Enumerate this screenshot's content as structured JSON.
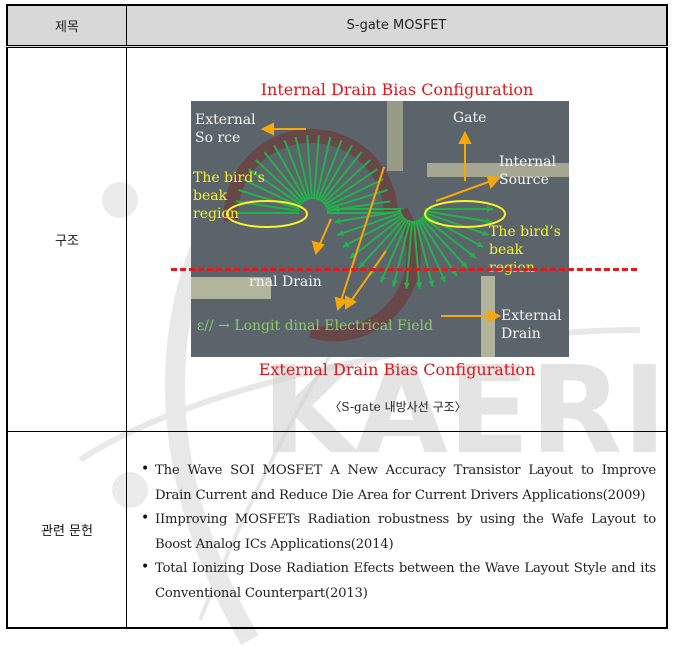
{
  "table": {
    "header": {
      "label": "제목",
      "value": "S-gate MOSFET"
    },
    "structure": {
      "label": "구조",
      "figure": {
        "title_top": "Internal Drain Bias Configuration",
        "title_bottom": "External Drain Bias Configuration",
        "labels": {
          "external_source": "External\nSo rce",
          "gate": "Gate",
          "internal_source": "Internal\nSource",
          "birds_beak_left": "The bird’s\nbeak\nregion",
          "birds_beak_right": "The bird’s\nbeak\nregion",
          "internal_drain": "rnal Drain",
          "legend": "ε// → Longit dinal Electrical Field",
          "external_drain": "External\nDrain"
        },
        "colors": {
          "title": "#e0161b",
          "arrow": "#f5a80a",
          "field": "#22b24c",
          "beak": "#f7f22a",
          "dash": "#e11b1b"
        }
      },
      "caption": "〈S-gate 내방사선 구조〉"
    },
    "references": {
      "label": "관련 문헌",
      "items": [
        "The Wave SOI MOSFET A New Accuracy Transistor Layout to Improve Drain Current and Reduce Die Area for Current Drivers Applications(2009)",
        "IImproving MOSFETs Radiation robustness by using the Wafe Layout to Boost Analog ICs Applications(2014)",
        "Total Ionizing Dose Radiation Efects between the Wave Layout Style and its Conventional Counterpart(2013)"
      ]
    }
  },
  "watermark": {
    "text": "KAERI"
  }
}
